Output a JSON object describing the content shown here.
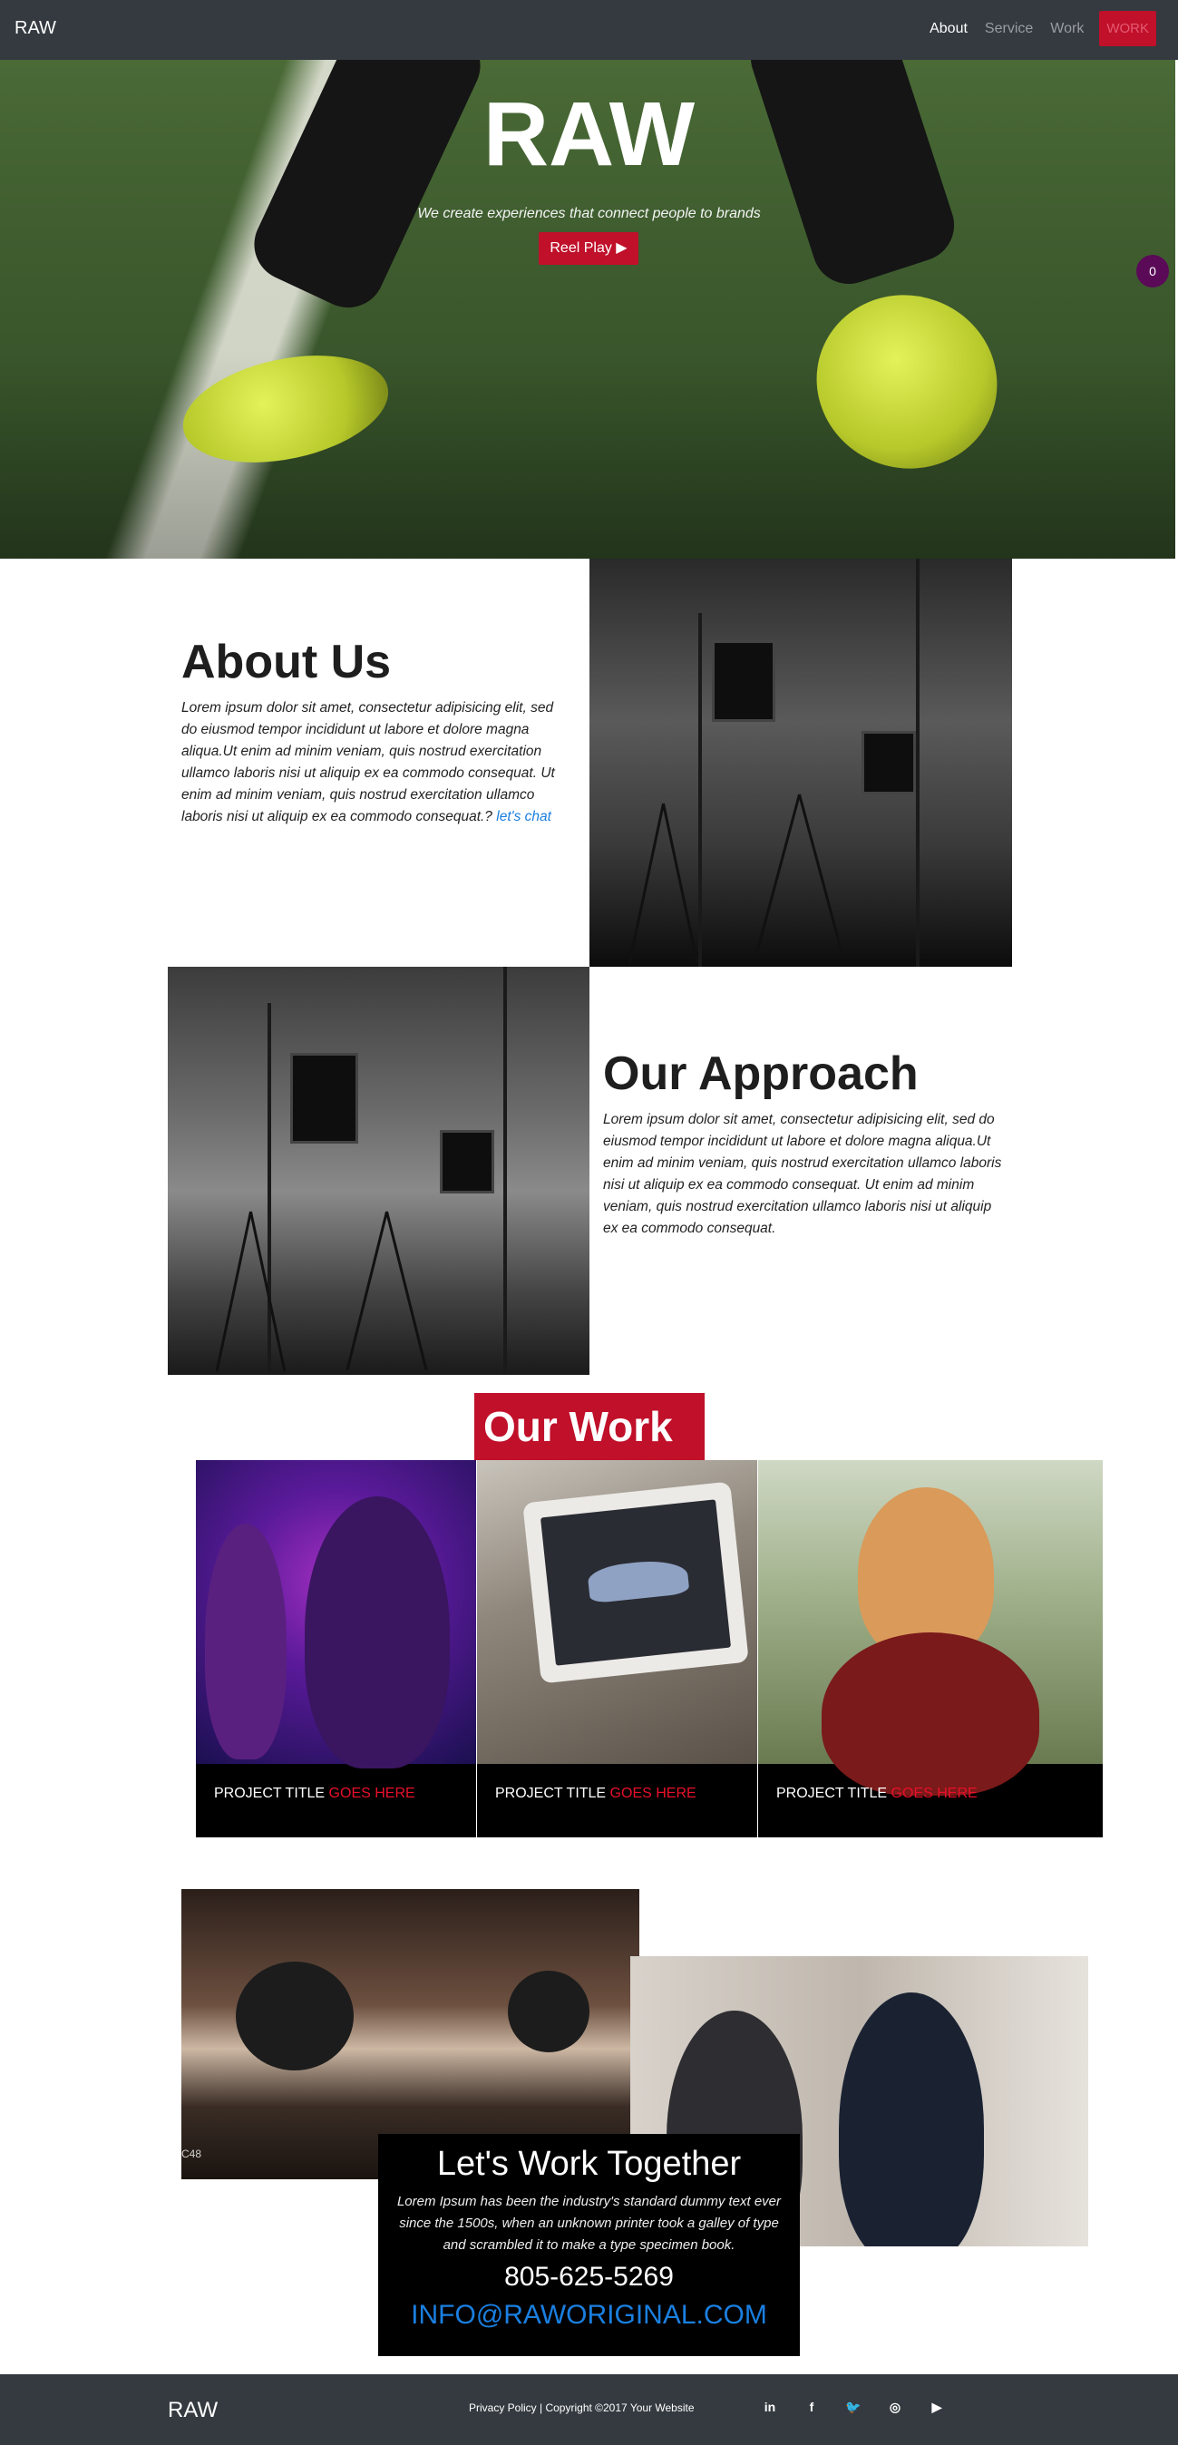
{
  "navbar": {
    "brand": "RAW",
    "links": [
      "About",
      "Service",
      "Work"
    ],
    "cta": "WORK"
  },
  "hero": {
    "title": "RAW",
    "subtitle": "We create experiences that connect people to brands",
    "button": "Reel Play ▶",
    "badge": "0"
  },
  "about": {
    "title": "About Us",
    "body": "Lorem ipsum dolor sit amet, consectetur adipisicing elit, sed do eiusmod tempor incididunt ut labore et dolore magna aliqua.Ut enim ad minim veniam, quis nostrud exercitation ullamco laboris nisi ut aliquip ex ea commodo consequat. Ut enim ad minim veniam, quis nostrud exercitation ullamco laboris nisi ut aliquip ex ea commodo consequat.?",
    "link": "let's chat"
  },
  "approach": {
    "title": "Our Approach",
    "body": "Lorem ipsum dolor sit amet, consectetur adipisicing elit, sed do eiusmod tempor incididunt ut labore et dolore magna aliqua.Ut enim ad minim veniam, quis nostrud exercitation ullamco laboris nisi ut aliquip ex ea commodo consequat. Ut enim ad minim veniam, quis nostrud exercitation ullamco laboris nisi ut aliquip ex ea commodo consequat."
  },
  "work": {
    "title": "Our Work",
    "projects": [
      {
        "label": "PROJECT TITLE ",
        "highlight": "GOES HERE"
      },
      {
        "label": "PROJECT TITLE ",
        "highlight": "GOES HERE"
      },
      {
        "label": "PROJECT TITLE ",
        "highlight": "GOES HERE"
      }
    ]
  },
  "together": {
    "title": "Let's Work Together",
    "body": "Lorem Ipsum has been the industry's standard dummy text ever since the 1500s, when an unknown printer took a galley of type and scrambled it to make a type specimen book.",
    "phone": "805-625-5269",
    "email": "INFO@RAWORIGINAL.COM",
    "watermark": "C48"
  },
  "footer": {
    "brand": "RAW",
    "copyright": "Privacy Policy | Copyright ©2017 Your Website",
    "socials": [
      "in",
      "f",
      "🐦",
      "◎",
      "▶"
    ]
  },
  "colors": {
    "accent": "#c0102a",
    "navbar": "#343a40",
    "link": "#1a7fe0",
    "badge": "#5a0a57"
  }
}
